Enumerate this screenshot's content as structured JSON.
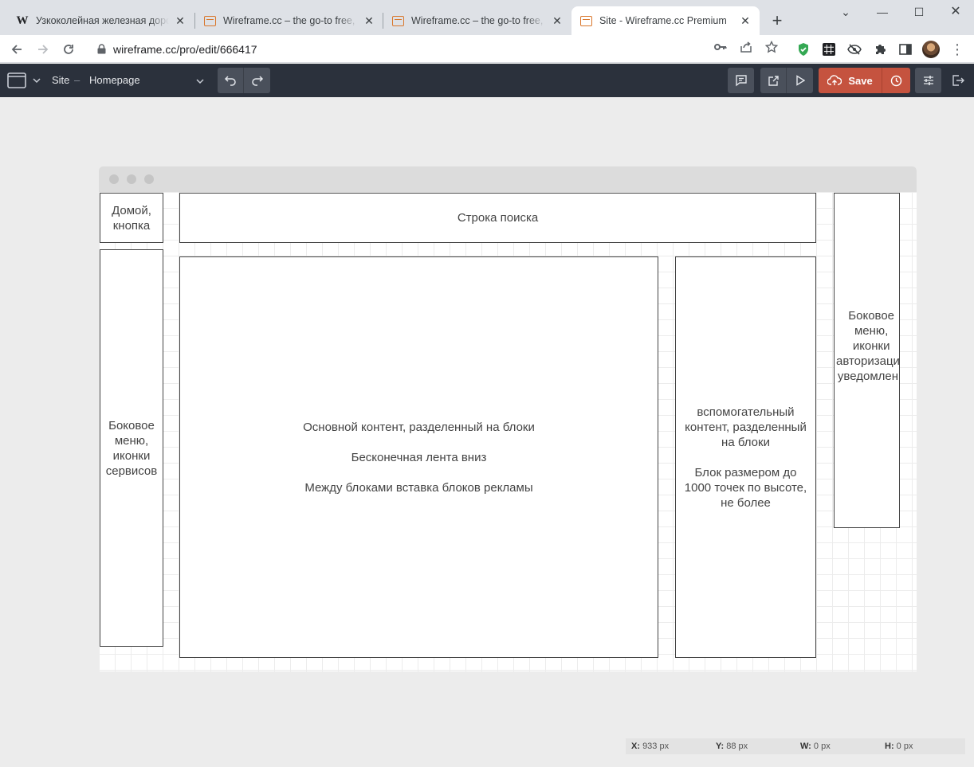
{
  "browser": {
    "tabs": [
      {
        "title": "Узкоколейная железная дорога",
        "favicon": "wikipedia-icon",
        "active": false
      },
      {
        "title": "Wireframe.cc – the go-to free, online",
        "favicon": "wireframe-icon",
        "active": false
      },
      {
        "title": "Wireframe.cc – the go-to free, online",
        "favicon": "wireframe-icon",
        "active": false
      },
      {
        "title": "Site - Wireframe.cc Premium",
        "favicon": "wireframe-icon",
        "active": true
      }
    ],
    "url": "wireframe.cc/pro/edit/666417"
  },
  "toolbar": {
    "project": "Site",
    "separator": "–",
    "page": "Homepage",
    "save_label": "Save",
    "colors": {
      "bar": "#2b313c",
      "save": "#c5533f"
    }
  },
  "canvas": {
    "boxes": {
      "home": "Домой,\nкнопка",
      "search": "Строка поиска",
      "left_menu": "Боковое\nменю,\nиконки\nсервисов",
      "main": "Основной контент, разделенный на блоки\n\nБесконечная лента вниз\n\nМежду блоками вставка блоков рекламы",
      "secondary": "вспомогательный\nконтент, разделенный\nна блоки\n\nБлок размером до\n1000 точек по высоте,\nне более",
      "right_menu": "Боковое\nменю,\nиконки\nавторизации\nуведомлени"
    }
  },
  "status": {
    "x_label": "X:",
    "x_value": "933 px",
    "y_label": "Y:",
    "y_value": "88 px",
    "w_label": "W:",
    "w_value": "0 px",
    "h_label": "H:",
    "h_value": "0 px"
  }
}
